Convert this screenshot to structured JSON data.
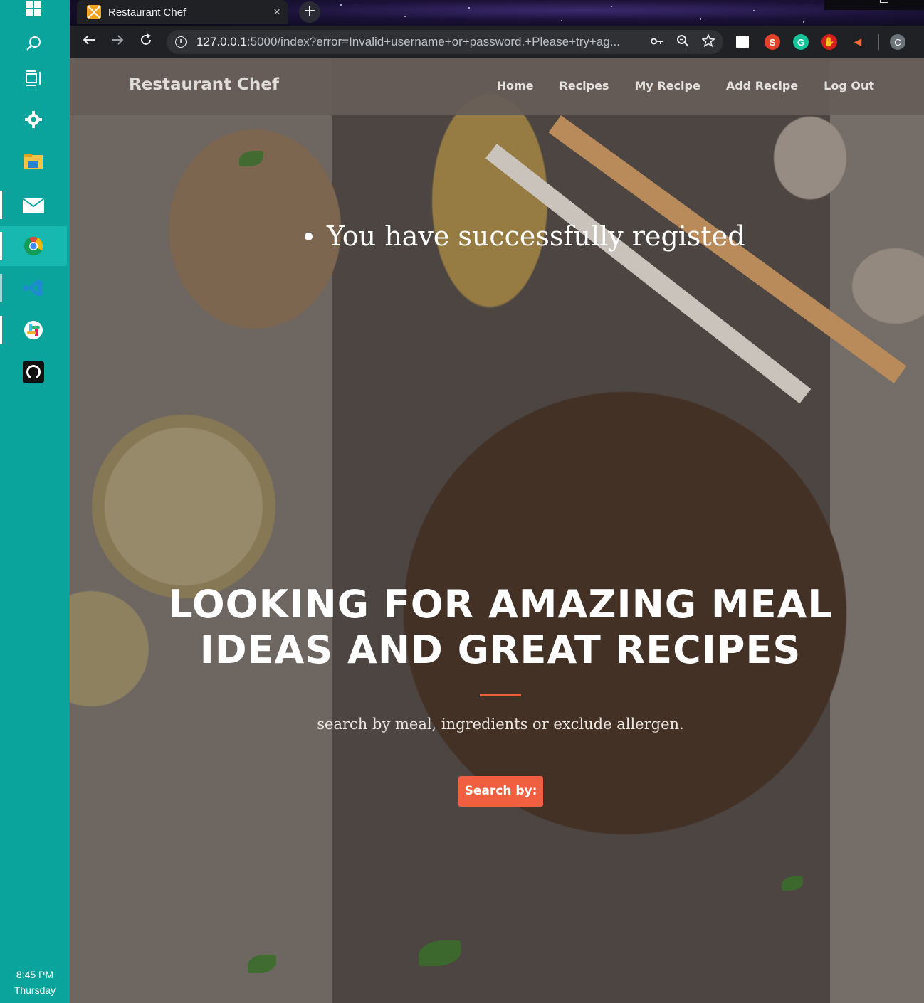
{
  "taskbar": {
    "items": [
      "windows-start",
      "search",
      "task-view",
      "settings",
      "file-explorer",
      "mail",
      "chrome",
      "vscode",
      "slack",
      "github"
    ],
    "clock": {
      "time": "8:45 PM",
      "day": "Thursday"
    }
  },
  "browser": {
    "tab": {
      "title": "Restaurant Chef",
      "close": "×"
    },
    "new_tab": "+",
    "url_host": "127.0.0.1",
    "url_rest": ":5000/index?error=Invalid+username+or+password.+Please+try+ag...",
    "profile_initial": "C"
  },
  "site": {
    "brand": "Restaurant Chef",
    "nav": [
      "Home",
      "Recipes",
      "My Recipe",
      "Add Recipe",
      "Log Out"
    ],
    "flash_message": "You have successfully registed",
    "hero": {
      "title_line1": "LOOKING FOR AMAZING MEAL",
      "title_line2": "IDEAS AND GREAT RECIPES",
      "subtitle": "search by meal, ingredients or exclude allergen.",
      "button": "Search by:"
    },
    "accent_color": "#f05f40"
  }
}
